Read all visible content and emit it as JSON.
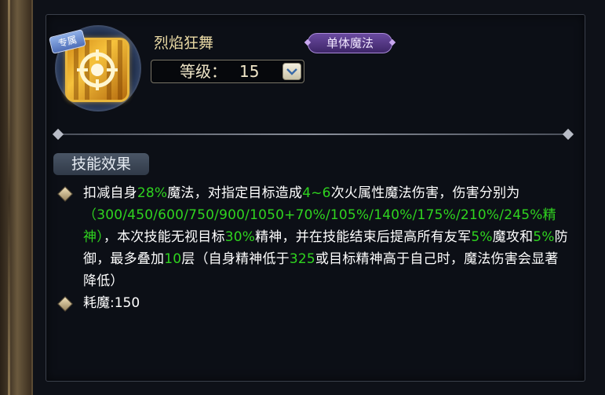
{
  "skill": {
    "name": "烈焰狂舞",
    "tag": "专属",
    "type_badge": "单体魔法",
    "level_label": "等级：",
    "level_value": "15"
  },
  "effect": {
    "section_label": "技能效果",
    "description_segments": [
      {
        "text": "扣减自身",
        "highlight": false
      },
      {
        "text": "28%",
        "highlight": true
      },
      {
        "text": "魔法，对指定目标造成",
        "highlight": false
      },
      {
        "text": "4~6",
        "highlight": true
      },
      {
        "text": "次火属性魔法伤害，伤害分别为",
        "highlight": false
      },
      {
        "text": "（300/450/600/750/900/1050+70%/105%/140%/175%/210%/245%精神）",
        "highlight": true
      },
      {
        "text": "，本次技能无视目标",
        "highlight": false
      },
      {
        "text": "30%",
        "highlight": true
      },
      {
        "text": "精神，并在技能结束后提高所有友军",
        "highlight": false
      },
      {
        "text": "5%",
        "highlight": true
      },
      {
        "text": "魔攻和",
        "highlight": false
      },
      {
        "text": "5%",
        "highlight": true
      },
      {
        "text": "防御，最多叠加",
        "highlight": false
      },
      {
        "text": "10",
        "highlight": true
      },
      {
        "text": "层（自身精神低于",
        "highlight": false
      },
      {
        "text": "325",
        "highlight": true
      },
      {
        "text": "或目标精神高于自己时，魔法伤害会显著降低）",
        "highlight": false
      }
    ],
    "cost_text": "耗魔:150"
  },
  "colors": {
    "highlight": "#2fd41f",
    "text": "#ffffff",
    "name": "#e9d9a4"
  },
  "icons": [
    "skill-icon",
    "chevron-down-icon",
    "diamond-bullet-icon"
  ]
}
